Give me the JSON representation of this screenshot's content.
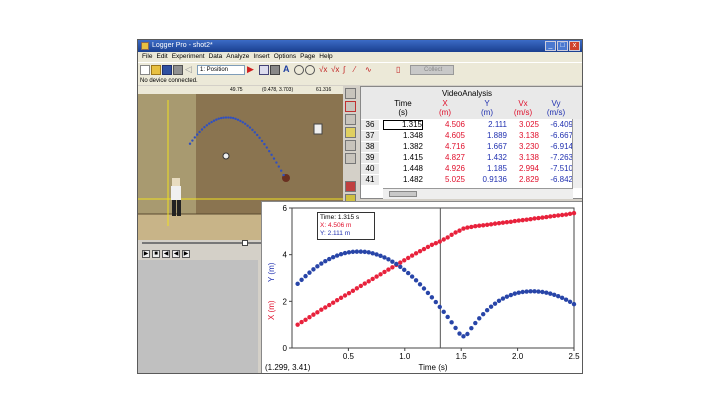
{
  "window": {
    "title": "Logger Pro - shot2*",
    "min_glyph": "_",
    "max_glyph": "□",
    "close_glyph": "x"
  },
  "menu": [
    "File",
    "Edit",
    "Experiment",
    "Data",
    "Analyze",
    "Insert",
    "Options",
    "Page",
    "Help"
  ],
  "toolbar": {
    "page_select_value": "1: Position",
    "collect_label": "Collect"
  },
  "status_text": "No device connected.",
  "video": {
    "ruler_labels": [
      "49.75",
      "(0.478, 3.703)",
      "61.316"
    ]
  },
  "table": {
    "dataset_title": "VideoAnalysis",
    "columns": [
      {
        "name": "Time",
        "unit": "(s)",
        "color": "#000000"
      },
      {
        "name": "X",
        "unit": "(m)",
        "color": "#e0102c"
      },
      {
        "name": "Y",
        "unit": "(m)",
        "color": "#2030b0"
      },
      {
        "name": "Vx",
        "unit": "(m/s)",
        "color": "#e0102c"
      },
      {
        "name": "Vy",
        "unit": "(m/s)",
        "color": "#2030b0"
      }
    ],
    "rows": [
      {
        "n": "36",
        "time": "1.315",
        "x": "4.506",
        "y": "2.111",
        "vx": "3.025",
        "vy": "-6.409"
      },
      {
        "n": "37",
        "time": "1.348",
        "x": "4.605",
        "y": "1.889",
        "vx": "3.138",
        "vy": "-6.667"
      },
      {
        "n": "38",
        "time": "1.382",
        "x": "4.716",
        "y": "1.667",
        "vx": "3.230",
        "vy": "-6.914"
      },
      {
        "n": "39",
        "time": "1.415",
        "x": "4.827",
        "y": "1.432",
        "vx": "3.138",
        "vy": "-7.263"
      },
      {
        "n": "40",
        "time": "1.448",
        "x": "4.926",
        "y": "1.185",
        "vx": "2.994",
        "vy": "-7.510"
      },
      {
        "n": "41",
        "time": "1.482",
        "x": "5.025",
        "y": "0.9136",
        "vx": "2.829",
        "vy": "-6.842"
      }
    ]
  },
  "graph": {
    "ylabel_x": "X (m)",
    "ylabel_y": "Y (m)",
    "xlabel": "Time (s)",
    "coord_readout": "(1.299, 3.41)",
    "tooltip": {
      "time": "Time: 1.315 s",
      "x": "X: 4.506 m",
      "y": "Y: 2.111 m"
    }
  },
  "chart_data": {
    "type": "scatter",
    "xlabel": "Time (s)",
    "ylabel": "X (m)  Y (m)",
    "xlim": [
      0,
      2.5
    ],
    "ylim": [
      0,
      6
    ],
    "x_ticks": [
      0.5,
      1.0,
      1.5,
      2.0,
      2.5
    ],
    "y_ticks": [
      0,
      2,
      4,
      6
    ],
    "cursor_x": 1.315,
    "colors": {
      "x_series": "#e8223c",
      "y_series": "#2845a8"
    },
    "series": [
      {
        "name": "X (m)",
        "x": [
          0.05,
          0.085,
          0.12,
          0.155,
          0.19,
          0.225,
          0.26,
          0.295,
          0.33,
          0.365,
          0.4,
          0.435,
          0.47,
          0.505,
          0.54,
          0.575,
          0.61,
          0.645,
          0.68,
          0.715,
          0.75,
          0.785,
          0.82,
          0.855,
          0.89,
          0.925,
          0.96,
          0.995,
          1.03,
          1.065,
          1.1,
          1.135,
          1.17,
          1.205,
          1.24,
          1.275,
          1.31,
          1.345,
          1.38,
          1.415,
          1.45,
          1.485,
          1.52,
          1.555,
          1.59,
          1.625,
          1.66,
          1.695,
          1.73,
          1.765,
          1.8,
          1.835,
          1.87,
          1.905,
          1.94,
          1.975,
          2.01,
          2.045,
          2.08,
          2.115,
          2.15,
          2.185,
          2.22,
          2.255,
          2.29,
          2.325,
          2.36,
          2.395,
          2.43,
          2.465,
          2.5
        ],
        "values": [
          1.0,
          1.11,
          1.21,
          1.32,
          1.43,
          1.53,
          1.64,
          1.74,
          1.84,
          1.94,
          2.05,
          2.15,
          2.25,
          2.35,
          2.45,
          2.56,
          2.66,
          2.76,
          2.86,
          2.96,
          3.06,
          3.16,
          3.26,
          3.36,
          3.46,
          3.56,
          3.66,
          3.76,
          3.86,
          3.96,
          4.06,
          4.15,
          4.24,
          4.33,
          4.42,
          4.49,
          4.56,
          4.65,
          4.74,
          4.85,
          4.95,
          5.03,
          5.12,
          5.16,
          5.19,
          5.22,
          5.24,
          5.26,
          5.28,
          5.3,
          5.33,
          5.35,
          5.37,
          5.39,
          5.41,
          5.44,
          5.46,
          5.48,
          5.5,
          5.52,
          5.55,
          5.57,
          5.59,
          5.61,
          5.64,
          5.66,
          5.68,
          5.7,
          5.72,
          5.75,
          5.78
        ]
      },
      {
        "name": "Y (m)",
        "x": [
          0.05,
          0.085,
          0.12,
          0.155,
          0.19,
          0.225,
          0.26,
          0.295,
          0.33,
          0.365,
          0.4,
          0.435,
          0.47,
          0.505,
          0.54,
          0.575,
          0.61,
          0.645,
          0.68,
          0.715,
          0.75,
          0.785,
          0.82,
          0.855,
          0.89,
          0.925,
          0.96,
          0.995,
          1.03,
          1.065,
          1.1,
          1.135,
          1.17,
          1.205,
          1.24,
          1.275,
          1.31,
          1.345,
          1.38,
          1.415,
          1.45,
          1.485,
          1.52,
          1.555,
          1.59,
          1.625,
          1.66,
          1.695,
          1.73,
          1.765,
          1.8,
          1.835,
          1.87,
          1.905,
          1.94,
          1.975,
          2.01,
          2.045,
          2.08,
          2.115,
          2.15,
          2.185,
          2.22,
          2.255,
          2.29,
          2.325,
          2.36,
          2.395,
          2.43,
          2.465,
          2.5
        ],
        "values": [
          2.75,
          2.92,
          3.08,
          3.23,
          3.37,
          3.5,
          3.62,
          3.72,
          3.81,
          3.89,
          3.96,
          4.02,
          4.07,
          4.1,
          4.12,
          4.13,
          4.13,
          4.12,
          4.1,
          4.06,
          4.01,
          3.95,
          3.88,
          3.8,
          3.7,
          3.6,
          3.48,
          3.35,
          3.21,
          3.06,
          2.9,
          2.73,
          2.55,
          2.36,
          2.17,
          1.97,
          1.76,
          1.55,
          1.33,
          1.1,
          0.86,
          0.62,
          0.5,
          0.6,
          0.85,
          1.07,
          1.27,
          1.45,
          1.62,
          1.77,
          1.9,
          2.02,
          2.12,
          2.2,
          2.27,
          2.33,
          2.37,
          2.4,
          2.42,
          2.43,
          2.43,
          2.42,
          2.4,
          2.37,
          2.33,
          2.28,
          2.22,
          2.15,
          2.07,
          1.98,
          1.88
        ]
      }
    ]
  }
}
